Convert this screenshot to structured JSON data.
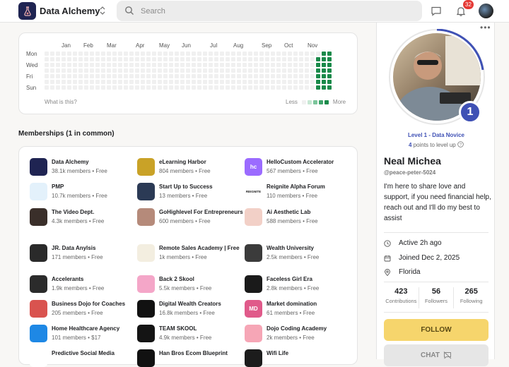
{
  "topbar": {
    "brand": "Data Alchemy",
    "search_placeholder": "Search",
    "notification_count": "32",
    "icons": [
      "flask-icon",
      "chevron-updown-icon",
      "search-icon",
      "chat-icon",
      "bell-icon",
      "avatar"
    ]
  },
  "activity": {
    "months": [
      "Jan",
      "Feb",
      "Mar",
      "Apr",
      "May",
      "Jun",
      "Jul",
      "Aug",
      "Sep",
      "Oct",
      "Nov"
    ],
    "days": [
      "Mon",
      "Wed",
      "Fri",
      "Sun"
    ],
    "what_is_this": "What is this?",
    "legend_less": "Less",
    "legend_more": "More",
    "active_color": "#1a8a4a"
  },
  "memberships": {
    "title": "Memberships (1 in common)",
    "items": [
      {
        "name": "Data Alchemy",
        "meta": "38.1k members • Free",
        "color": "#1f2452",
        "abbr": ""
      },
      {
        "name": "eLearning Harbor",
        "meta": "804 members • Free",
        "color": "#c9a227",
        "abbr": ""
      },
      {
        "name": "HelloCustom Accelerator",
        "meta": "567 members • Free",
        "color": "#9b6bff",
        "abbr": "hc"
      },
      {
        "name": "PMP",
        "meta": "10.7k members • Free",
        "color": "#e3f1fb",
        "abbr": ""
      },
      {
        "name": "Start Up to Success",
        "meta": "13 members • Free",
        "color": "#2b3a55",
        "abbr": ""
      },
      {
        "name": "Reignite Alpha Forum",
        "meta": "110 members • Free",
        "color": "#ffffff",
        "abbr": "REIGNITE"
      },
      {
        "name": "The Video Dept.",
        "meta": "4.3k members • Free",
        "color": "#3a2f2a",
        "abbr": ""
      },
      {
        "name": "GoHighlevel For Entrepreneurs",
        "meta": "600 members • Free",
        "color": "#b58a7a",
        "abbr": ""
      },
      {
        "name": "Ai Aesthetic Lab",
        "meta": "588 members • Free",
        "color": "#f2d0c7",
        "abbr": ""
      },
      {
        "name": "JR. Data Anylsis",
        "meta": "171 members • Free",
        "color": "#2a2a2a",
        "abbr": ""
      },
      {
        "name": "Remote Sales Academy | Free",
        "meta": "1k members • Free",
        "color": "#f3eee0",
        "abbr": ""
      },
      {
        "name": "Wealth University",
        "meta": "2.5k members • Free",
        "color": "#3b3b3b",
        "abbr": ""
      },
      {
        "name": "Accelerants",
        "meta": "1.9k members • Free",
        "color": "#2b2b2b",
        "abbr": ""
      },
      {
        "name": "Back 2 Skool",
        "meta": "5.5k members • Free",
        "color": "#f4a6c8",
        "abbr": ""
      },
      {
        "name": "Faceless Girl Era",
        "meta": "2.8k members • Free",
        "color": "#1a1a1a",
        "abbr": ""
      },
      {
        "name": "Business Dojo for Coaches",
        "meta": "205 members • Free",
        "color": "#d9534f",
        "abbr": ""
      },
      {
        "name": "Digital Wealth Creators",
        "meta": "16.8k members • Free",
        "color": "#111111",
        "abbr": ""
      },
      {
        "name": "Market domination",
        "meta": "61 members • Free",
        "color": "#e05a8a",
        "abbr": "MD"
      },
      {
        "name": "Home Healthcare Agency",
        "meta": "101 members • $17",
        "color": "#1e88e5",
        "abbr": ""
      },
      {
        "name": "TEAM SKOOL",
        "meta": "4.9k members • Free",
        "color": "#141414",
        "abbr": ""
      },
      {
        "name": "Dojo Coding Academy",
        "meta": "2k members • Free",
        "color": "#f6a6b6",
        "abbr": ""
      },
      {
        "name": "Predictive Social Media",
        "meta": "",
        "color": "#ffffff",
        "abbr": ""
      },
      {
        "name": "Han Bros Ecom Blueprint",
        "meta": "",
        "color": "#111111",
        "abbr": ""
      },
      {
        "name": "Wifi Life",
        "meta": "",
        "color": "#1c1c1c",
        "abbr": ""
      }
    ]
  },
  "profile": {
    "more": "•••",
    "level_number": "1",
    "level_label": "Level 1 - Data Novice",
    "points_number": "4",
    "points_text": " points to level up",
    "name": "Neal Michea",
    "handle": "@peace-peter-5024",
    "bio": "I'm here to share love and support, if you need financial help, reach out and I'll do my best to assist",
    "active": "Active 2h ago",
    "joined": "Joined Dec 2, 2025",
    "location": "Florida",
    "stats": [
      {
        "value": "423",
        "label": "Contributions"
      },
      {
        "value": "56",
        "label": "Followers"
      },
      {
        "value": "265",
        "label": "Following"
      }
    ],
    "follow_label": "FOLLOW",
    "chat_label": "CHAT",
    "accent": "#3f51b5",
    "follow_color": "#f6d56c"
  }
}
